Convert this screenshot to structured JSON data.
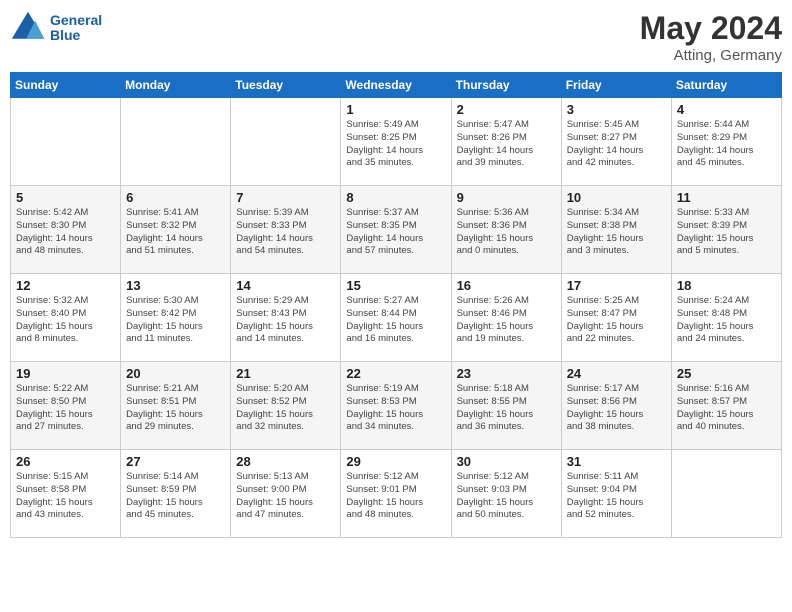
{
  "header": {
    "logo_line1": "General",
    "logo_line2": "Blue",
    "month": "May 2024",
    "location": "Atting, Germany"
  },
  "weekdays": [
    "Sunday",
    "Monday",
    "Tuesday",
    "Wednesday",
    "Thursday",
    "Friday",
    "Saturday"
  ],
  "weeks": [
    [
      {
        "day": "",
        "info": ""
      },
      {
        "day": "",
        "info": ""
      },
      {
        "day": "",
        "info": ""
      },
      {
        "day": "1",
        "info": "Sunrise: 5:49 AM\nSunset: 8:25 PM\nDaylight: 14 hours\nand 35 minutes."
      },
      {
        "day": "2",
        "info": "Sunrise: 5:47 AM\nSunset: 8:26 PM\nDaylight: 14 hours\nand 39 minutes."
      },
      {
        "day": "3",
        "info": "Sunrise: 5:45 AM\nSunset: 8:27 PM\nDaylight: 14 hours\nand 42 minutes."
      },
      {
        "day": "4",
        "info": "Sunrise: 5:44 AM\nSunset: 8:29 PM\nDaylight: 14 hours\nand 45 minutes."
      }
    ],
    [
      {
        "day": "5",
        "info": "Sunrise: 5:42 AM\nSunset: 8:30 PM\nDaylight: 14 hours\nand 48 minutes."
      },
      {
        "day": "6",
        "info": "Sunrise: 5:41 AM\nSunset: 8:32 PM\nDaylight: 14 hours\nand 51 minutes."
      },
      {
        "day": "7",
        "info": "Sunrise: 5:39 AM\nSunset: 8:33 PM\nDaylight: 14 hours\nand 54 minutes."
      },
      {
        "day": "8",
        "info": "Sunrise: 5:37 AM\nSunset: 8:35 PM\nDaylight: 14 hours\nand 57 minutes."
      },
      {
        "day": "9",
        "info": "Sunrise: 5:36 AM\nSunset: 8:36 PM\nDaylight: 15 hours\nand 0 minutes."
      },
      {
        "day": "10",
        "info": "Sunrise: 5:34 AM\nSunset: 8:38 PM\nDaylight: 15 hours\nand 3 minutes."
      },
      {
        "day": "11",
        "info": "Sunrise: 5:33 AM\nSunset: 8:39 PM\nDaylight: 15 hours\nand 5 minutes."
      }
    ],
    [
      {
        "day": "12",
        "info": "Sunrise: 5:32 AM\nSunset: 8:40 PM\nDaylight: 15 hours\nand 8 minutes."
      },
      {
        "day": "13",
        "info": "Sunrise: 5:30 AM\nSunset: 8:42 PM\nDaylight: 15 hours\nand 11 minutes."
      },
      {
        "day": "14",
        "info": "Sunrise: 5:29 AM\nSunset: 8:43 PM\nDaylight: 15 hours\nand 14 minutes."
      },
      {
        "day": "15",
        "info": "Sunrise: 5:27 AM\nSunset: 8:44 PM\nDaylight: 15 hours\nand 16 minutes."
      },
      {
        "day": "16",
        "info": "Sunrise: 5:26 AM\nSunset: 8:46 PM\nDaylight: 15 hours\nand 19 minutes."
      },
      {
        "day": "17",
        "info": "Sunrise: 5:25 AM\nSunset: 8:47 PM\nDaylight: 15 hours\nand 22 minutes."
      },
      {
        "day": "18",
        "info": "Sunrise: 5:24 AM\nSunset: 8:48 PM\nDaylight: 15 hours\nand 24 minutes."
      }
    ],
    [
      {
        "day": "19",
        "info": "Sunrise: 5:22 AM\nSunset: 8:50 PM\nDaylight: 15 hours\nand 27 minutes."
      },
      {
        "day": "20",
        "info": "Sunrise: 5:21 AM\nSunset: 8:51 PM\nDaylight: 15 hours\nand 29 minutes."
      },
      {
        "day": "21",
        "info": "Sunrise: 5:20 AM\nSunset: 8:52 PM\nDaylight: 15 hours\nand 32 minutes."
      },
      {
        "day": "22",
        "info": "Sunrise: 5:19 AM\nSunset: 8:53 PM\nDaylight: 15 hours\nand 34 minutes."
      },
      {
        "day": "23",
        "info": "Sunrise: 5:18 AM\nSunset: 8:55 PM\nDaylight: 15 hours\nand 36 minutes."
      },
      {
        "day": "24",
        "info": "Sunrise: 5:17 AM\nSunset: 8:56 PM\nDaylight: 15 hours\nand 38 minutes."
      },
      {
        "day": "25",
        "info": "Sunrise: 5:16 AM\nSunset: 8:57 PM\nDaylight: 15 hours\nand 40 minutes."
      }
    ],
    [
      {
        "day": "26",
        "info": "Sunrise: 5:15 AM\nSunset: 8:58 PM\nDaylight: 15 hours\nand 43 minutes."
      },
      {
        "day": "27",
        "info": "Sunrise: 5:14 AM\nSunset: 8:59 PM\nDaylight: 15 hours\nand 45 minutes."
      },
      {
        "day": "28",
        "info": "Sunrise: 5:13 AM\nSunset: 9:00 PM\nDaylight: 15 hours\nand 47 minutes."
      },
      {
        "day": "29",
        "info": "Sunrise: 5:12 AM\nSunset: 9:01 PM\nDaylight: 15 hours\nand 48 minutes."
      },
      {
        "day": "30",
        "info": "Sunrise: 5:12 AM\nSunset: 9:03 PM\nDaylight: 15 hours\nand 50 minutes."
      },
      {
        "day": "31",
        "info": "Sunrise: 5:11 AM\nSunset: 9:04 PM\nDaylight: 15 hours\nand 52 minutes."
      },
      {
        "day": "",
        "info": ""
      }
    ]
  ]
}
